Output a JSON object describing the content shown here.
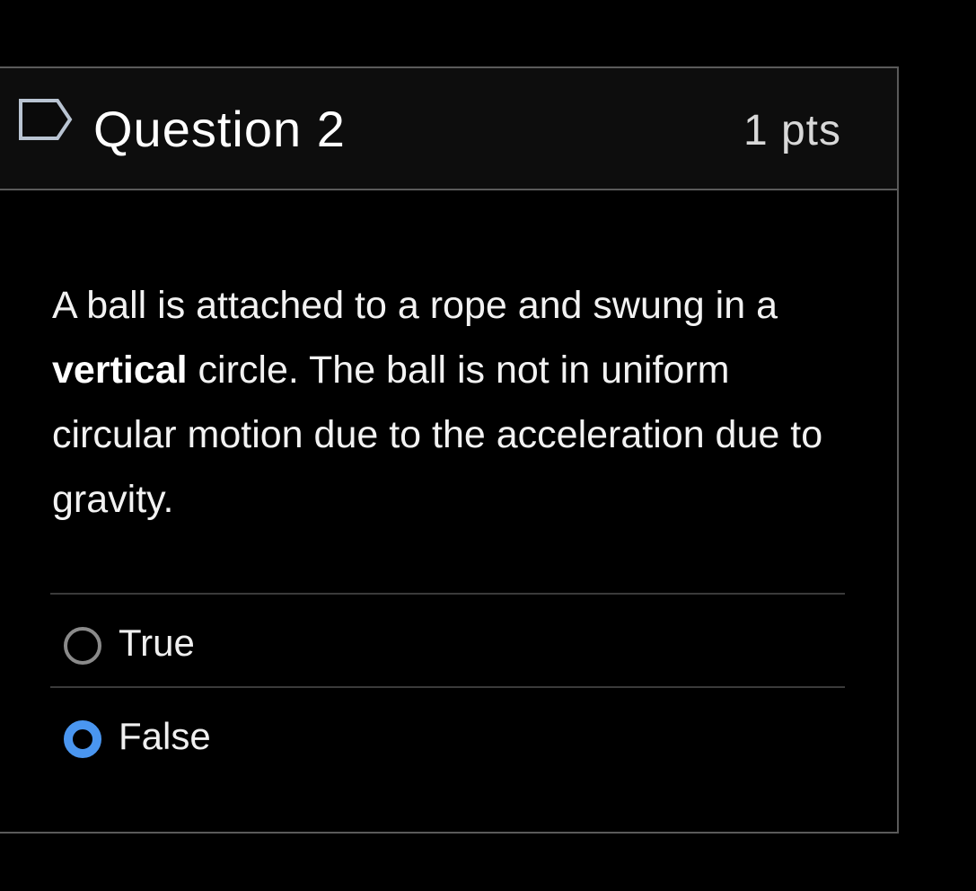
{
  "question": {
    "title": "Question 2",
    "points": "1 pts",
    "flag_icon": "flag-outline-icon",
    "text_before_bold": "A ball is attached to a rope and swung in a ",
    "text_bold": "vertical",
    "text_after_bold": " circle.  The ball is not in uniform circular motion due to the acceleration due to gravity."
  },
  "answers": [
    {
      "label": "True",
      "selected": false
    },
    {
      "label": "False",
      "selected": true
    }
  ],
  "colors": {
    "background": "#000000",
    "header_background": "#0d0d0d",
    "border": "#5a5a5a",
    "radio_selected": "#4a96f0",
    "radio_unselected": "#8a8a8a"
  }
}
